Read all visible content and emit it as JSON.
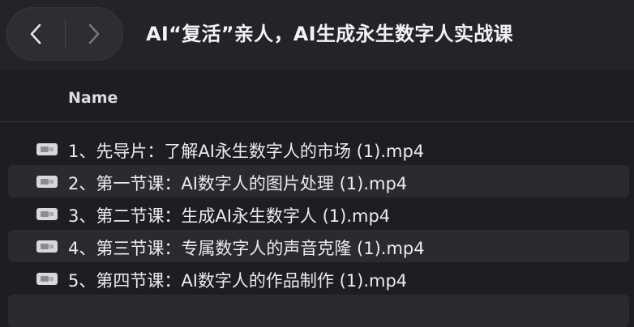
{
  "window": {
    "title": "AI“复活”亲人，AI生成永生数字人实战课"
  },
  "nav": {
    "back_icon": "chevron-left-icon",
    "forward_icon": "chevron-right-icon"
  },
  "columns": {
    "name": "Name"
  },
  "files": [
    {
      "name": "1、先导片：了解AI永生数字人的市场 (1).mp4",
      "icon": "video-thumbnail-icon"
    },
    {
      "name": "2、第一节课：AI数字人的图片处理 (1).mp4",
      "icon": "video-thumbnail-icon"
    },
    {
      "name": "3、第二节课：生成AI永生数字人 (1).mp4",
      "icon": "video-thumbnail-icon"
    },
    {
      "name": "4、第三节课：专属数字人的声音克隆 (1).mp4",
      "icon": "video-thumbnail-icon"
    },
    {
      "name": "5、第四节课：AI数字人的作品制作 (1).mp4",
      "icon": "video-thumbnail-icon"
    }
  ]
}
